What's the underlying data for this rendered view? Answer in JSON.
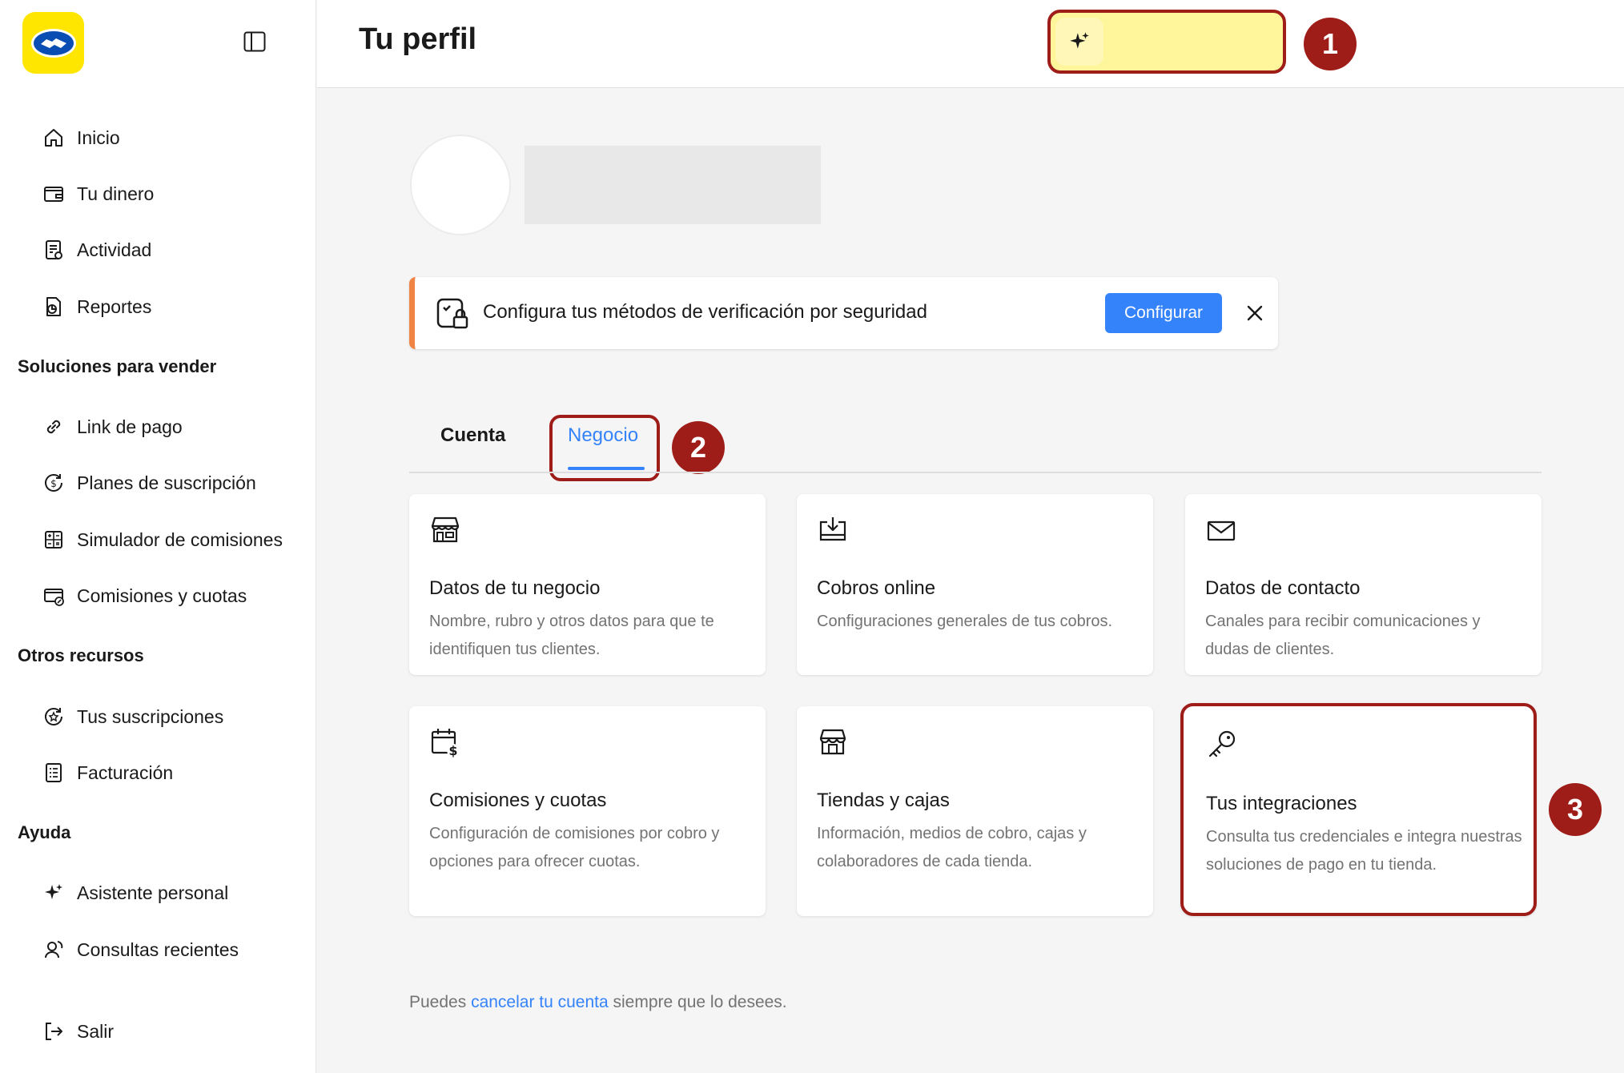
{
  "header": {
    "title": "Tu perfil"
  },
  "sidebar": {
    "main_items": [
      {
        "label": "Inicio",
        "icon": "home-icon"
      },
      {
        "label": "Tu dinero",
        "icon": "wallet-icon"
      },
      {
        "label": "Actividad",
        "icon": "activity-icon"
      },
      {
        "label": "Reportes",
        "icon": "reports-icon"
      }
    ],
    "sections": [
      {
        "title": "Soluciones para vender",
        "items": [
          {
            "label": "Link de pago",
            "icon": "link-icon"
          },
          {
            "label": "Planes de suscripción",
            "icon": "subscription-plan-icon"
          },
          {
            "label": "Simulador de comisiones",
            "icon": "calculator-icon"
          },
          {
            "label": "Comisiones y cuotas",
            "icon": "commission-icon"
          }
        ]
      },
      {
        "title": "Otros recursos",
        "items": [
          {
            "label": "Tus suscripciones",
            "icon": "star-badge-icon"
          },
          {
            "label": "Facturación",
            "icon": "invoice-icon"
          }
        ]
      },
      {
        "title": "Ayuda",
        "items": [
          {
            "label": "Asistente personal",
            "icon": "sparkle-icon"
          },
          {
            "label": "Consultas recientes",
            "icon": "support-icon"
          }
        ]
      }
    ],
    "logout": {
      "label": "Salir",
      "icon": "logout-icon"
    }
  },
  "banner": {
    "text": "Configura tus métodos de verificación por seguridad",
    "button": "Configurar"
  },
  "tabs": [
    {
      "label": "Cuenta",
      "active": false
    },
    {
      "label": "Negocio",
      "active": true
    }
  ],
  "cards": [
    {
      "title": "Datos de tu negocio",
      "desc": "Nombre, rubro y otros datos para que te identifiquen tus clientes.",
      "icon": "store-icon"
    },
    {
      "title": "Cobros online",
      "desc": "Configuraciones generales de tus cobros.",
      "icon": "download-tray-icon"
    },
    {
      "title": "Datos de contacto",
      "desc": "Canales para recibir comunicaciones y dudas de clientes.",
      "icon": "envelope-icon"
    },
    {
      "title": "Comisiones y cuotas",
      "desc": "Configuración de comisiones por cobro y opciones para ofrecer cuotas.",
      "icon": "calendar-money-icon"
    },
    {
      "title": "Tiendas y cajas",
      "desc": "Información, medios de cobro, cajas y colaboradores de cada tienda.",
      "icon": "shop-icon"
    },
    {
      "title": "Tus integraciones",
      "desc": "Consulta tus credenciales e integra nuestras soluciones de pago en tu tienda.",
      "icon": "key-icon"
    }
  ],
  "footer": {
    "before": "Puedes ",
    "link": "cancelar tu cuenta",
    "after": " siempre que lo desees."
  },
  "annotations": [
    "1",
    "2",
    "3"
  ],
  "colors": {
    "accent": "#3483fa",
    "brand": "#ffe600",
    "annotation": "#9e1d18",
    "banner_stripe": "#f08445"
  }
}
